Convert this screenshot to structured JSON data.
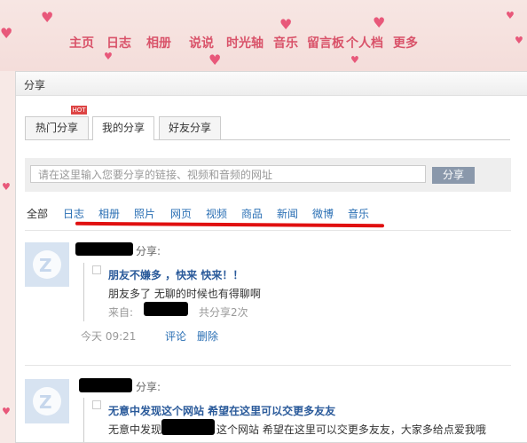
{
  "nav": {
    "items": [
      "主页",
      "日志",
      "相册",
      "说说",
      "时光轴",
      "音乐",
      "留言板",
      "个人档",
      "更多"
    ]
  },
  "panel": {
    "title": "分享",
    "tabs": [
      "热门分享",
      "我的分享",
      "好友分享"
    ],
    "hot_badge": "HOT",
    "share_input_placeholder": "请在这里输入您要分享的链接、视频和音频的网址",
    "share_button": "分享",
    "filters": [
      "全部",
      "日志",
      "相册",
      "照片",
      "网页",
      "视频",
      "商品",
      "新闻",
      "微博",
      "音乐"
    ]
  },
  "posts": [
    {
      "action": "分享:",
      "title": "朋友不嫌多 ，快来 快来！！",
      "text": "朋友多了 无聊的时候也有得聊啊",
      "source_label": "来自:",
      "share_count": "共分享2次",
      "time": "今天 09:21",
      "comment": "评论",
      "delete": "删除"
    },
    {
      "action": "分享:",
      "title": "无意中发现这个网站 希望在这里可以交更多友友",
      "text_part1": "无意中发现",
      "text_part2": "这个网站 希望在这里可以交更多友友，大家多给点爱我哦"
    }
  ],
  "colors": {
    "nav_text": "#d9536a",
    "link": "#2a6fb4",
    "highlight_line": "#e01010",
    "button": "#8a98ab"
  }
}
